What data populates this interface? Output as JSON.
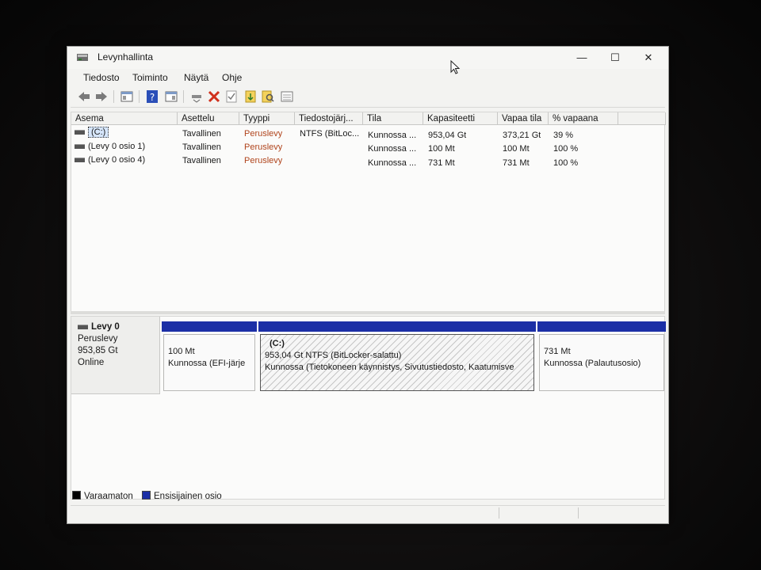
{
  "window": {
    "title": "Levynhallinta",
    "buttons": {
      "minimize": "—",
      "maximize": "☐",
      "close": "✕"
    }
  },
  "menu": [
    "Tiedosto",
    "Toiminto",
    "Näytä",
    "Ohje"
  ],
  "toolbar_icons": [
    "back-icon",
    "forward-icon",
    "console-tree-icon",
    "help-icon",
    "properties-icon",
    "connect-icon",
    "delete-icon",
    "check-icon",
    "import-icon",
    "search-icon",
    "list-view-icon"
  ],
  "volume_list": {
    "columns": [
      "Asema",
      "Asettelu",
      "Tyyppi",
      "Tiedostojärj...",
      "Tila",
      "Kapasiteetti",
      "Vapaa tila",
      "% vapaana"
    ],
    "rows": [
      {
        "name": "(C:)",
        "layout": "Tavallinen",
        "type": "Peruslevy",
        "fs": "NTFS (BitLoc...",
        "status": "Kunnossa ...",
        "capacity": "953,04 Gt",
        "free": "373,21 Gt",
        "pct": "39 %"
      },
      {
        "name": "(Levy 0 osio 1)",
        "layout": "Tavallinen",
        "type": "Peruslevy",
        "fs": "",
        "status": "Kunnossa ...",
        "capacity": "100 Mt",
        "free": "100 Mt",
        "pct": "100 %"
      },
      {
        "name": "(Levy 0 osio 4)",
        "layout": "Tavallinen",
        "type": "Peruslevy",
        "fs": "",
        "status": "Kunnossa ...",
        "capacity": "731 Mt",
        "free": "731 Mt",
        "pct": "100 %"
      }
    ]
  },
  "disk": {
    "name": "Levy 0",
    "type": "Peruslevy",
    "size": "953,85 Gt",
    "state": "Online",
    "partitions": [
      {
        "label": "",
        "line1": "100 Mt",
        "line2": "Kunnossa (EFI-järje"
      },
      {
        "label": "(C:)",
        "line1": "953,04 Gt NTFS (BitLocker-salattu)",
        "line2": "Kunnossa (Tietokoneen käynnistys, Sivutustiedosto, Kaatumisve"
      },
      {
        "label": "",
        "line1": "731 Mt",
        "line2": "Kunnossa (Palautusosio)"
      }
    ]
  },
  "legend": [
    {
      "label": "Varaamaton",
      "color": "#000000"
    },
    {
      "label": "Ensisijainen osio",
      "color": "#1b2fa6"
    }
  ],
  "colors": {
    "partition_bar": "#1b2fa6",
    "selection": "#d6e6fb"
  }
}
